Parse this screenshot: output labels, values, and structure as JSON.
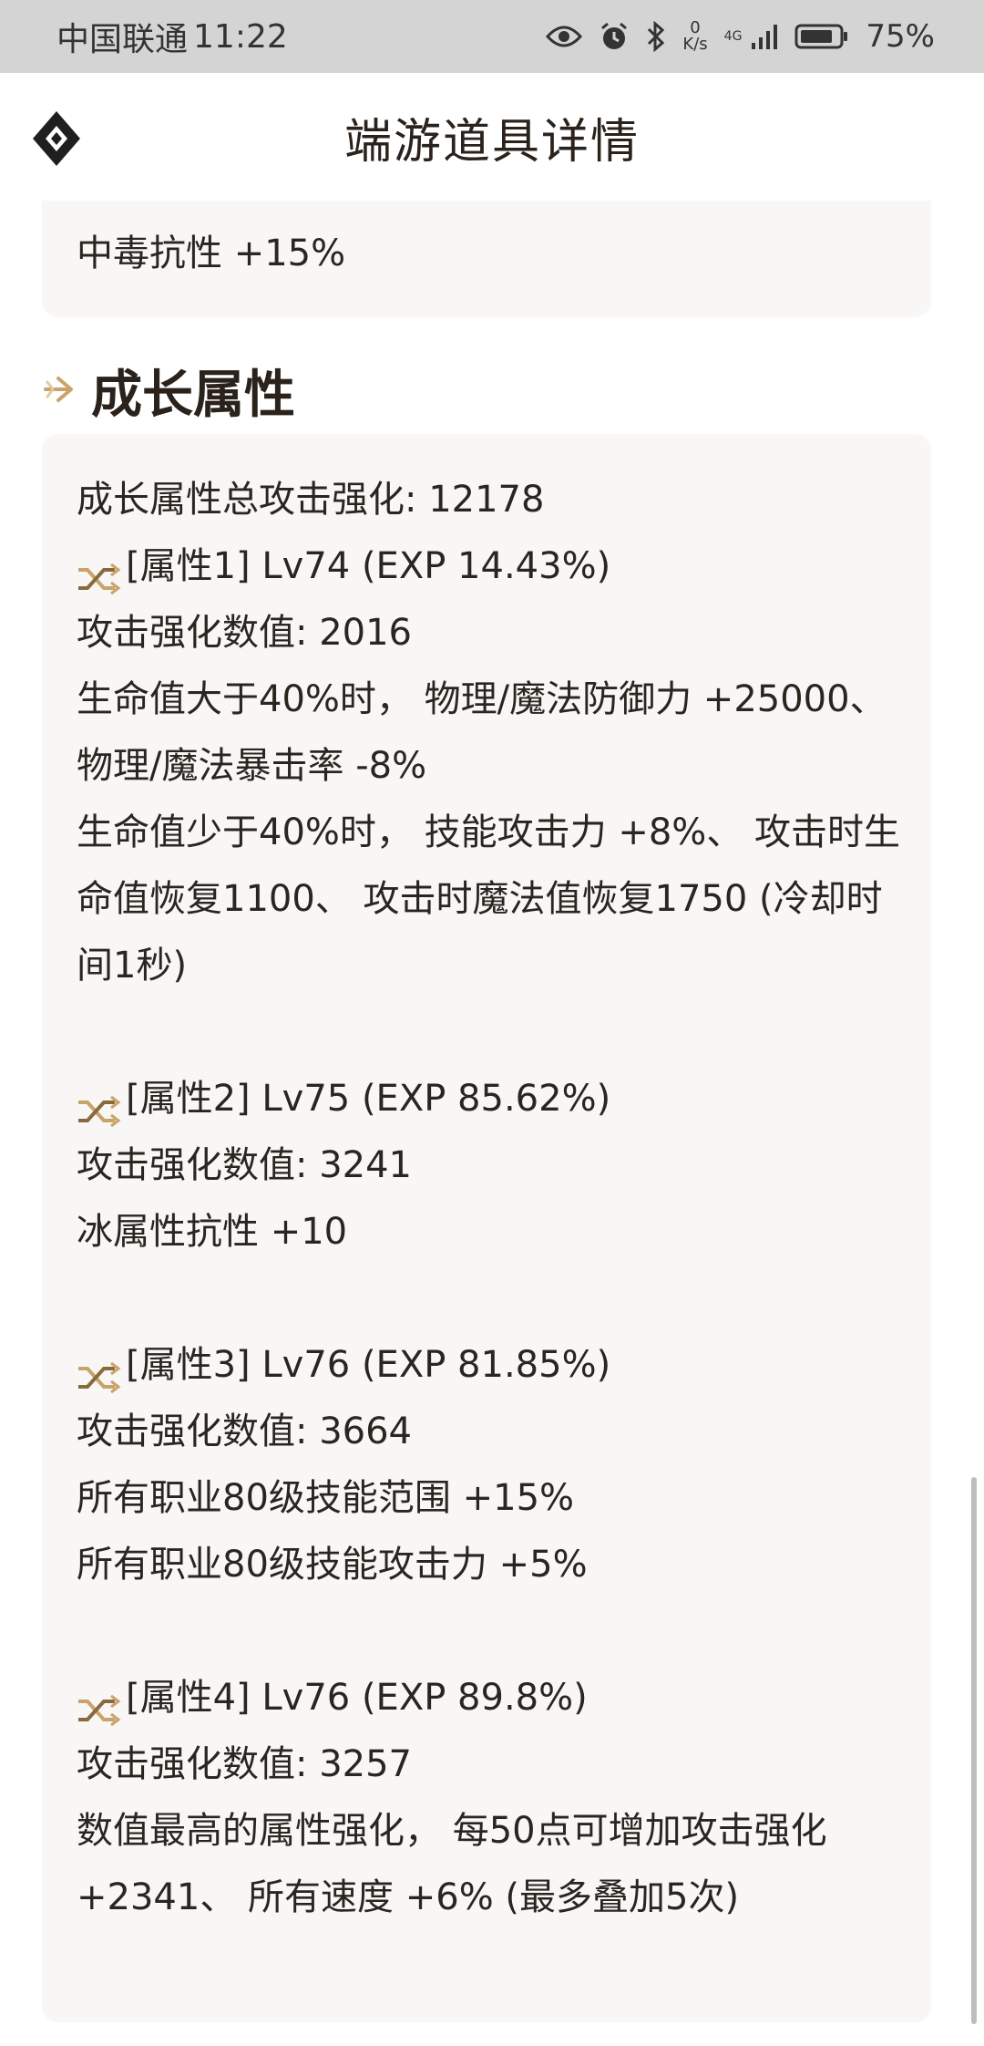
{
  "status_bar": {
    "carrier": "中国联通",
    "time": "11:22",
    "speed_value": "0",
    "speed_unit": "K/s",
    "network": "4G",
    "battery": "75%"
  },
  "header": {
    "title": "端游道具详情"
  },
  "top_card": {
    "line": "中毒抗性 +15%"
  },
  "section": {
    "title": "成长属性"
  },
  "growth": {
    "total": "成长属性总攻击强化: 12178",
    "attributes": [
      {
        "head": "[属性1] Lv74 (EXP 14.43%)",
        "lines": [
          "攻击强化数值:  2016",
          "生命值大于40%时， 物理/魔法防御力 +25000、",
          "物理/魔法暴击率 -8%",
          "生命值少于40%时， 技能攻击力 +8%、 攻击时生",
          "命值恢复1100、 攻击时魔法值恢复1750 (冷却时",
          "间1秒)"
        ]
      },
      {
        "head": "[属性2] Lv75 (EXP 85.62%)",
        "lines": [
          "攻击强化数值:  3241",
          "冰属性抗性 +10"
        ]
      },
      {
        "head": "[属性3] Lv76 (EXP 81.85%)",
        "lines": [
          "攻击强化数值:  3664",
          "所有职业80级技能范围 +15%",
          "所有职业80级技能攻击力 +5%"
        ]
      },
      {
        "head": "[属性4] Lv76 (EXP 89.8%)",
        "lines": [
          "攻击强化数值:  3257",
          "数值最高的属性强化， 每50点可增加攻击强化",
          "+2341、 所有速度 +6% (最多叠加5次)"
        ]
      }
    ]
  },
  "colors": {
    "accent_gold": "#c9a36a",
    "card_bg": "#f8f7f6",
    "text": "#2b2520"
  },
  "icons": {
    "logo": "diamond-logo-icon",
    "section": "arrow-right-icon",
    "attribute": "shuffle-icon"
  }
}
